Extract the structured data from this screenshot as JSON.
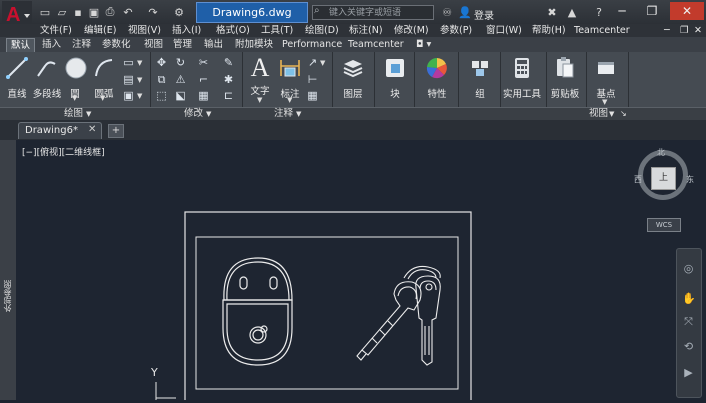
{
  "app": {
    "document_title": "Drawing6.dwg",
    "search_placeholder": "键入关键字或短语",
    "login_label": "登录",
    "colors": {
      "accent": "#1f5fa8",
      "logo_red": "#c8102e",
      "canvas": "#1e2531",
      "ribbon": "#454b52"
    }
  },
  "quick_access": {
    "icons": [
      "new-icon",
      "open-icon",
      "save-icon",
      "saveas-icon",
      "print-icon",
      "undo-icon",
      "redo-icon",
      "workspace-icon"
    ]
  },
  "window_controls": {
    "minimize": "─",
    "restore": "❐",
    "close": "✕"
  },
  "menubar": {
    "items": [
      "文件(F)",
      "编辑(E)",
      "视图(V)",
      "插入(I)",
      "格式(O)",
      "工具(T)",
      "绘图(D)",
      "标注(N)",
      "修改(M)",
      "参数(P)",
      "窗口(W)",
      "帮助(H)",
      "Teamcenter"
    ]
  },
  "ribbon_tabs": {
    "items": [
      "默认",
      "插入",
      "注释",
      "参数化",
      "视图",
      "管理",
      "输出",
      "附加模块",
      "Performance",
      "Teamcenter"
    ],
    "active": "默认"
  },
  "ribbon": {
    "draw": {
      "line": "直线",
      "polyline": "多段线",
      "circle": "圆",
      "arc": "圆弧",
      "panel": "绘图"
    },
    "modify": {
      "panel": "修改"
    },
    "annotation": {
      "text": "文字",
      "dimension": "标注",
      "panel": "注释"
    },
    "layers": {
      "label": "图层"
    },
    "block": {
      "label": "块"
    },
    "properties": {
      "label": "特性"
    },
    "groups": {
      "label": "组"
    },
    "utilities": {
      "label": "实用工具"
    },
    "clipboard": {
      "label": "剪贴板"
    },
    "view": {
      "basepoint": "基点",
      "panel": "视图"
    }
  },
  "file_tabs": {
    "active": "Drawing6*",
    "new_tab": "+"
  },
  "canvas": {
    "view_label": "[−][俯视][二维线框]",
    "xref_label": "外部参照",
    "ucs_y": "Y"
  },
  "viewcube": {
    "north": "北",
    "west": "西",
    "east": "东",
    "top": "上",
    "wcs": "WCS"
  }
}
